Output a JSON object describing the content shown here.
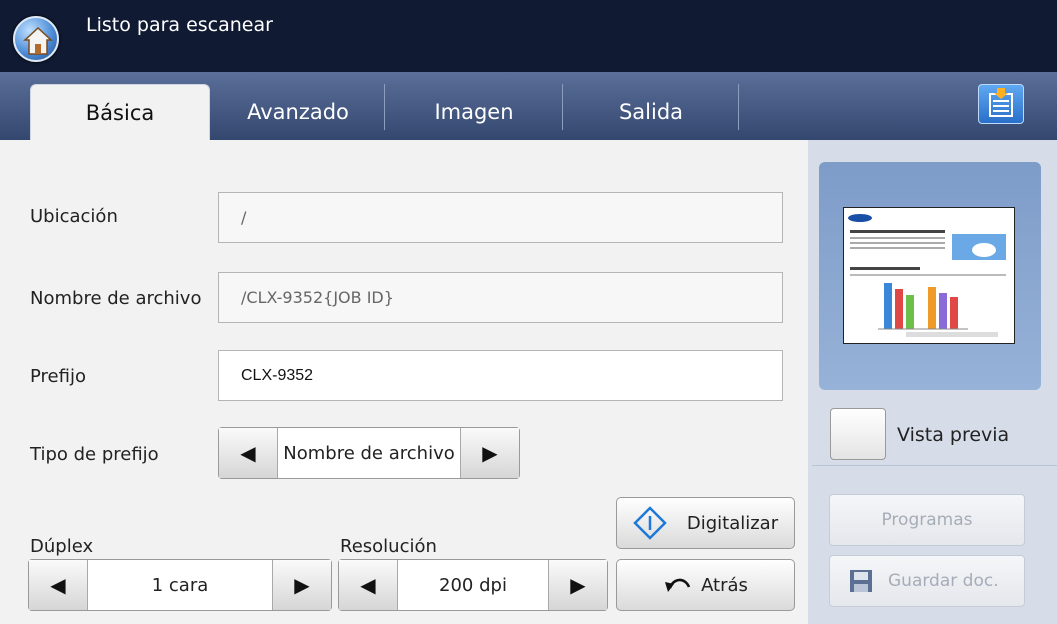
{
  "header": {
    "status": "Listo para escanear"
  },
  "tabs": [
    "Básica",
    "Avanzado",
    "Imagen",
    "Salida"
  ],
  "form": {
    "location_label": "Ubicación",
    "location_value": "/",
    "filename_label": "Nombre de archivo",
    "filename_value": "/CLX-9352{JOB ID}",
    "prefix_label": "Prefijo",
    "prefix_value": "CLX-9352",
    "prefix_type_label": "Tipo de prefijo",
    "prefix_type_value": "Nombre de archivo",
    "duplex_label": "Dúplex",
    "duplex_value": "1 cara",
    "resolution_label": "Resolución",
    "resolution_value": "200 dpi"
  },
  "actions": {
    "scan": "Digitalizar",
    "back": "Atrás"
  },
  "side": {
    "preview_label": "Vista previa",
    "programs": "Programas",
    "save_doc": "Guardar doc."
  },
  "icons": {
    "home": "home-icon",
    "menu": "document-menu-icon",
    "left": "arrow-left-icon",
    "right": "arrow-right-icon",
    "scan": "diamond-start-icon",
    "back": "undo-arrow-icon",
    "save": "floppy-disk-icon"
  },
  "colors": {
    "header_bg": "#101a33",
    "tabbar_bg": "#3f5279",
    "side_bg": "#d6dde9",
    "accent": "#2a6fc9"
  }
}
